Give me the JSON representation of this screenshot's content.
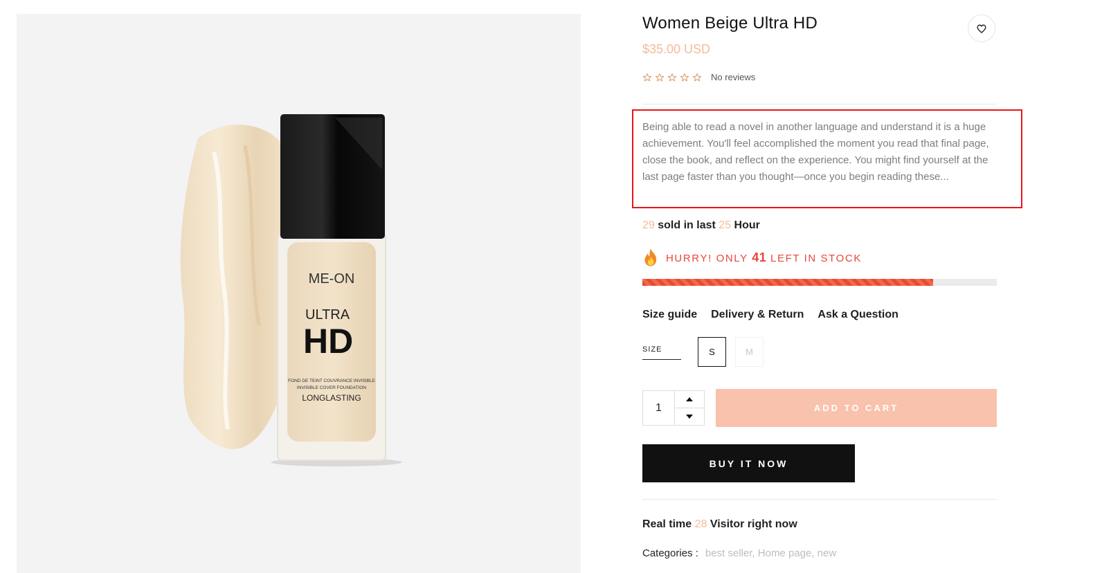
{
  "product": {
    "title": "Women Beige Ultra HD",
    "price": "$35.00 USD",
    "rating_stars": 0,
    "reviews_label": "No reviews",
    "description": "Being able to read a novel in another language and understand it is a huge achievement. You'll feel accomplished the moment you read that final page, close the book, and reflect on the experience. You might find yourself at the last page faster than you thought—once you begin reading these...",
    "image": {
      "brand": "ME-ON",
      "line1": "ULTRA",
      "line2": "HD",
      "fine_print_1": "FOND DE TEINT COUVRANCE INVISIBLE",
      "fine_print_2": "INVISIBLE COVER FOUNDATION",
      "tagline": "LONGLASTING"
    }
  },
  "sold": {
    "count": "29",
    "mid": " sold in last ",
    "hours": "25",
    "suffix": " Hour"
  },
  "stock": {
    "prefix": "HURRY! ONLY ",
    "count": "41",
    "suffix": " LEFT IN STOCK",
    "level": 0.82
  },
  "links": {
    "size_guide": "Size guide",
    "delivery": "Delivery & Return",
    "ask": "Ask a Question"
  },
  "size": {
    "label": "SIZE",
    "options": [
      "S",
      "M"
    ],
    "selected": "S"
  },
  "quantity": {
    "value": "1"
  },
  "buttons": {
    "add_to_cart": "ADD TO CART",
    "buy_now": "BUY IT NOW"
  },
  "visitors": {
    "prefix": "Real time ",
    "count": "28",
    "suffix": " Visitor right now"
  },
  "categories": {
    "label": "Categories :",
    "items": [
      "best seller",
      "Home page",
      "new"
    ]
  },
  "colors": {
    "accent": "#f5b99b",
    "stock_red": "#e8463a",
    "highlight_box": "#e8141b",
    "add_to_cart_bg": "#f9c2ac",
    "buy_now_bg": "#111111"
  },
  "icons": {
    "wishlist": "heart-icon",
    "stars": "star-outline-icon",
    "stock": "fire-icon",
    "qty_up": "caret-up-icon",
    "qty_down": "caret-down-icon"
  }
}
